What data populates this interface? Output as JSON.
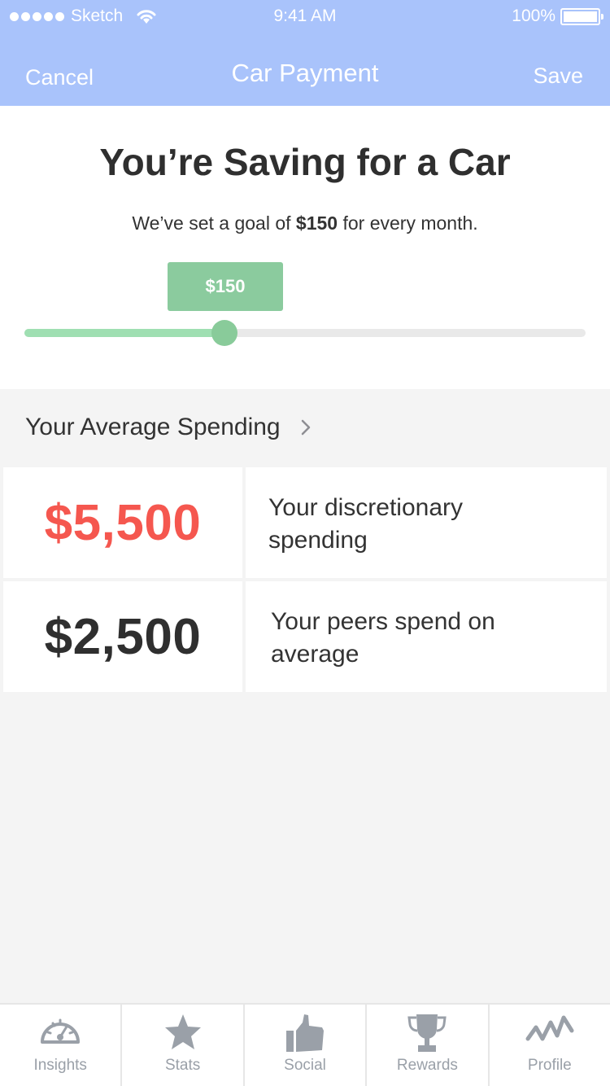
{
  "status": {
    "carrier": "Sketch",
    "time": "9:41 AM",
    "battery": "100%"
  },
  "nav": {
    "cancel": "Cancel",
    "title": "Car Payment",
    "save": "Save"
  },
  "goal": {
    "title": "You’re Saving for a Car",
    "subtitle_pre": "We’ve set a goal of ",
    "subtitle_amount": "$150",
    "subtitle_post": " for every month.",
    "slider_value_label": "$150",
    "slider_fraction": 0.357,
    "slider_color": "#8bcb9e"
  },
  "spending": {
    "header": "Your Average Spending",
    "rows": [
      {
        "amount": "$5,500",
        "label": "Your discretionary spending",
        "color": "#f5574f"
      },
      {
        "amount": "$2,500",
        "label": "Your peers spend on average",
        "color": "#2f2f2f"
      }
    ]
  },
  "tabs": [
    {
      "label": "Insights",
      "icon": "gauge-icon"
    },
    {
      "label": "Stats",
      "icon": "star-icon"
    },
    {
      "label": "Social",
      "icon": "thumbs-up-icon"
    },
    {
      "label": "Rewards",
      "icon": "trophy-icon"
    },
    {
      "label": "Profile",
      "icon": "activity-icon"
    }
  ]
}
